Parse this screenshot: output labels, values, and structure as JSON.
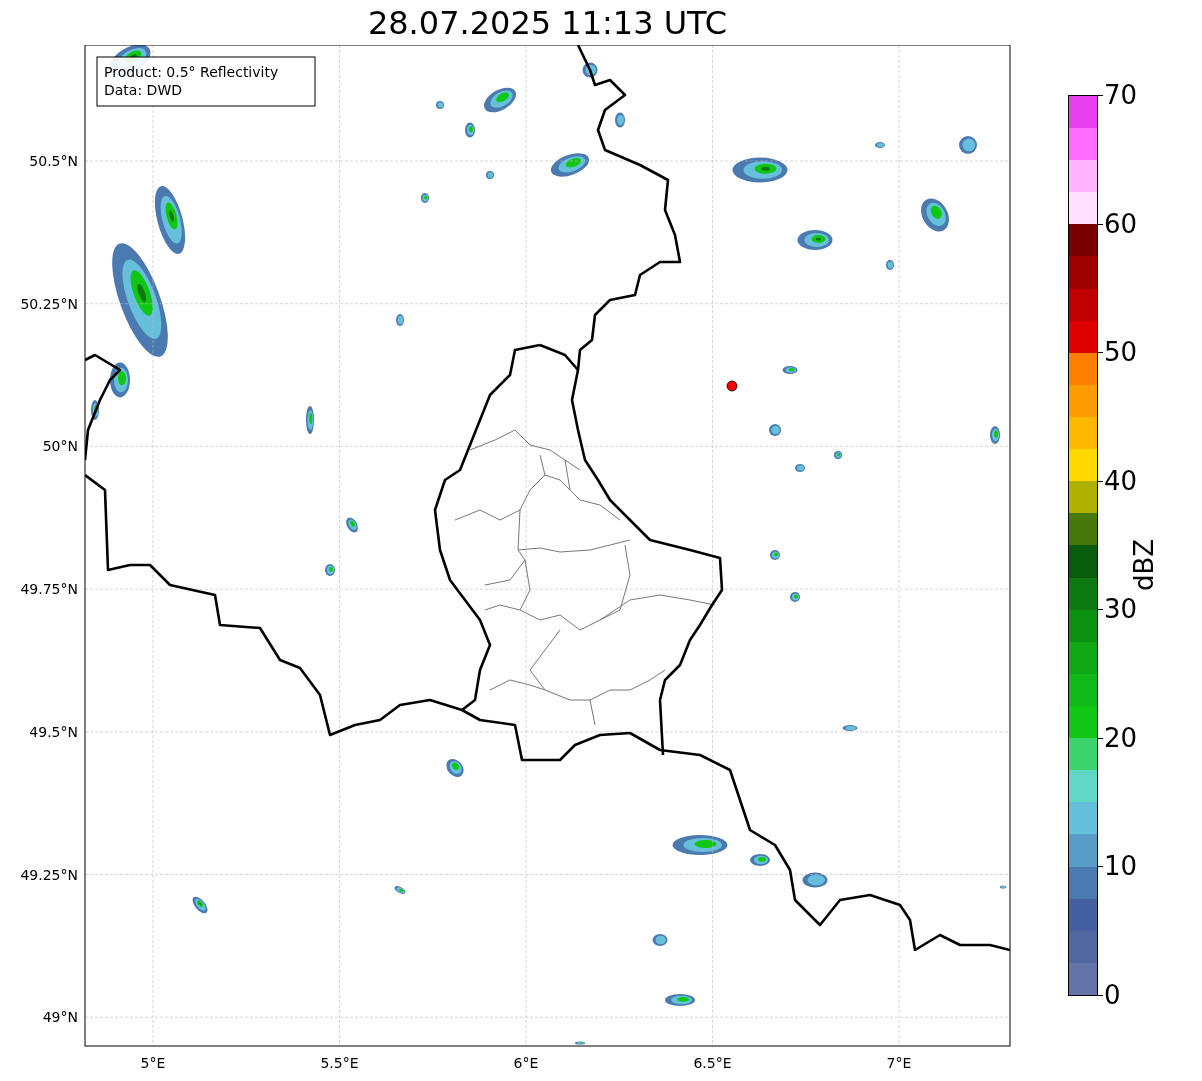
{
  "title": "28.07.2025 11:13 UTC",
  "map": {
    "legend": [
      "Product: 0.5° Reflectivity",
      "Data: DWD"
    ],
    "lat_labels": [
      "50.5°N",
      "50.25°N",
      "50°N",
      "49.75°N",
      "49.5°N",
      "49.25°N",
      "49°N"
    ],
    "lon_labels": [
      "5°E",
      "5.5°E",
      "6°E",
      "6.5°E",
      "7°E"
    ]
  },
  "colorbar": {
    "label": "dBZ",
    "ticks": [
      "70",
      "60",
      "50",
      "40",
      "30",
      "20",
      "10",
      "0"
    ],
    "bands": [
      {
        "color": "#6474a8"
      },
      {
        "color": "#52669f"
      },
      {
        "color": "#4460a0"
      },
      {
        "color": "#4b7ab0"
      },
      {
        "color": "#5a9cc8"
      },
      {
        "color": "#66c0dc"
      },
      {
        "color": "#5fd8c8"
      },
      {
        "color": "#3cd46c"
      },
      {
        "color": "#10c814"
      },
      {
        "color": "#10b818"
      },
      {
        "color": "#10a814"
      },
      {
        "color": "#0c9010"
      },
      {
        "color": "#0c7a10"
      },
      {
        "color": "#085c0c"
      },
      {
        "color": "#48780c"
      },
      {
        "color": "#b0b000"
      },
      {
        "color": "#ffd800"
      },
      {
        "color": "#ffb800"
      },
      {
        "color": "#ff9c00"
      },
      {
        "color": "#ff8000"
      },
      {
        "color": "#e00000"
      },
      {
        "color": "#c00000"
      },
      {
        "color": "#a00000"
      },
      {
        "color": "#780000"
      },
      {
        "color": "#ffe0ff"
      },
      {
        "color": "#ffb4ff"
      },
      {
        "color": "#ff6cff"
      },
      {
        "color": "#e840f0"
      }
    ]
  }
}
